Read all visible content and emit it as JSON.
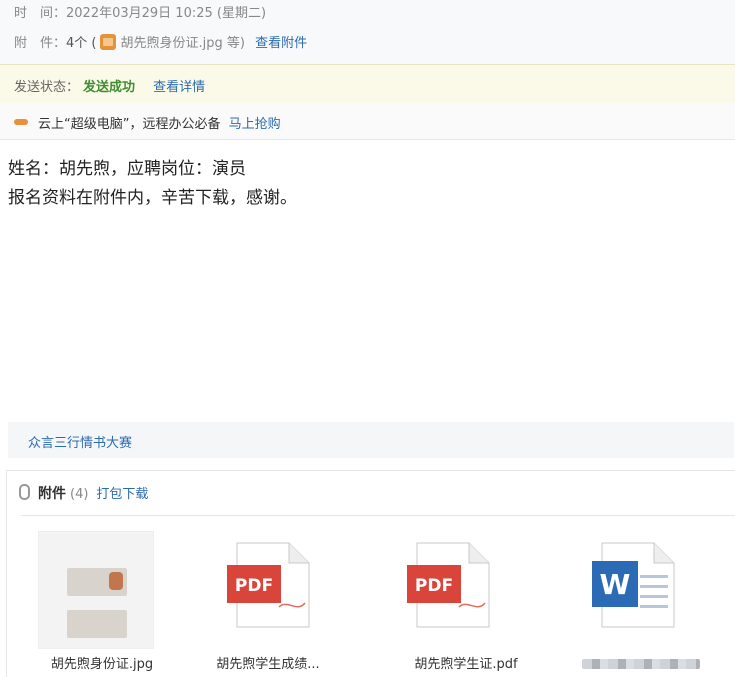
{
  "header": {
    "time_label": "时　间：",
    "time_value": "2022年03月29日 10:25 (星期二)",
    "attach_label": "附　件：",
    "attach_count": "4个 (",
    "attach_first": "胡先煦身份证.jpg 等)",
    "view_attachments": "查看附件"
  },
  "status": {
    "label": "发送状态：",
    "value": "发送成功",
    "details_link": "查看详情"
  },
  "ad": {
    "text": "云上“超级电脑”，远程办公必备",
    "link": "马上抢购"
  },
  "body": {
    "line1": "姓名：胡先煦，应聘岗位：演员",
    "line2": "报名资料在附件内，辛苦下载，感谢。"
  },
  "promo": {
    "text": "众言三行情书大赛"
  },
  "attachments": {
    "title": "附件",
    "count": "(4)",
    "download_all": "打包下载",
    "files": [
      {
        "name": "胡先煦身份证.jpg",
        "icon": "image-thumbnail-icon"
      },
      {
        "name": "胡先煦学生成绩...",
        "icon": "pdf-file-icon",
        "badge": "PDF"
      },
      {
        "name": "胡先煦学生证.pdf",
        "icon": "pdf-file-icon",
        "badge": "PDF"
      },
      {
        "name": "",
        "icon": "word-file-icon",
        "badge": "W"
      }
    ]
  },
  "colors": {
    "link": "#2c6bad",
    "success": "#3e8e2f",
    "pdf_red": "#d9443b",
    "word_blue": "#2b6bb5"
  }
}
